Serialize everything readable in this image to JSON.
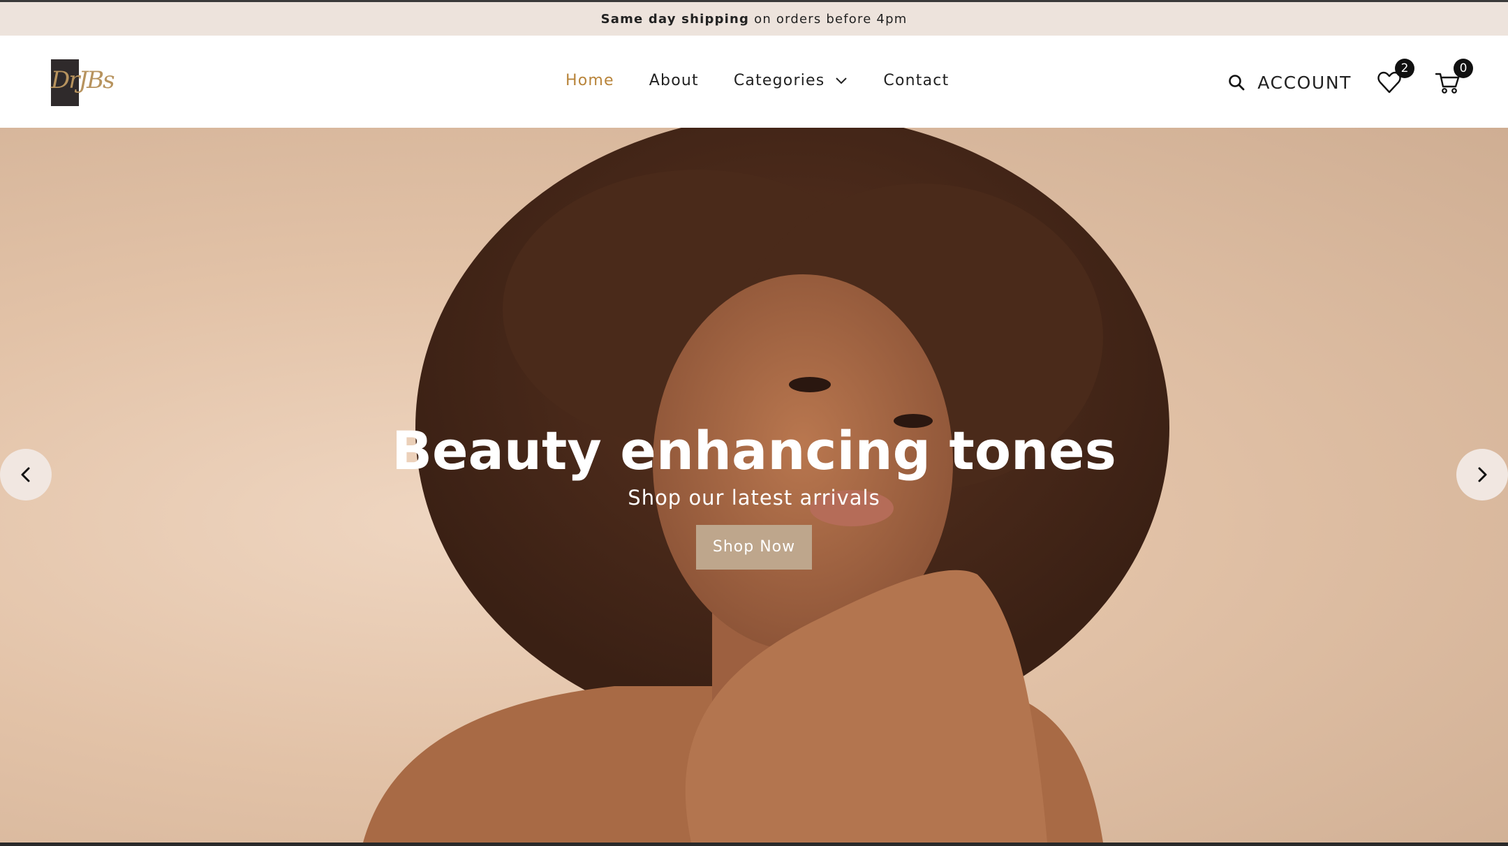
{
  "announcement": {
    "bold": "Same day shipping",
    "rest": "on orders before 4pm"
  },
  "logo": {
    "text": "DrJBs"
  },
  "nav": {
    "items": [
      {
        "label": "Home",
        "active": true
      },
      {
        "label": "About"
      },
      {
        "label": "Categories",
        "icon": "chevron-down-icon"
      },
      {
        "label": "Contact"
      }
    ]
  },
  "header_tools": {
    "account_label": "ACCOUNT",
    "wishlist_count": "2",
    "cart_count": "0"
  },
  "hero": {
    "title": "Beauty enhancing tones",
    "subtitle": "Shop our latest arrivals",
    "cta": "Shop Now"
  },
  "colors": {
    "accent": "#b8843a",
    "announcement_bg": "#ede3dc",
    "cta_bg": "#bea68c",
    "hero_bg": "#e2c2a7"
  }
}
